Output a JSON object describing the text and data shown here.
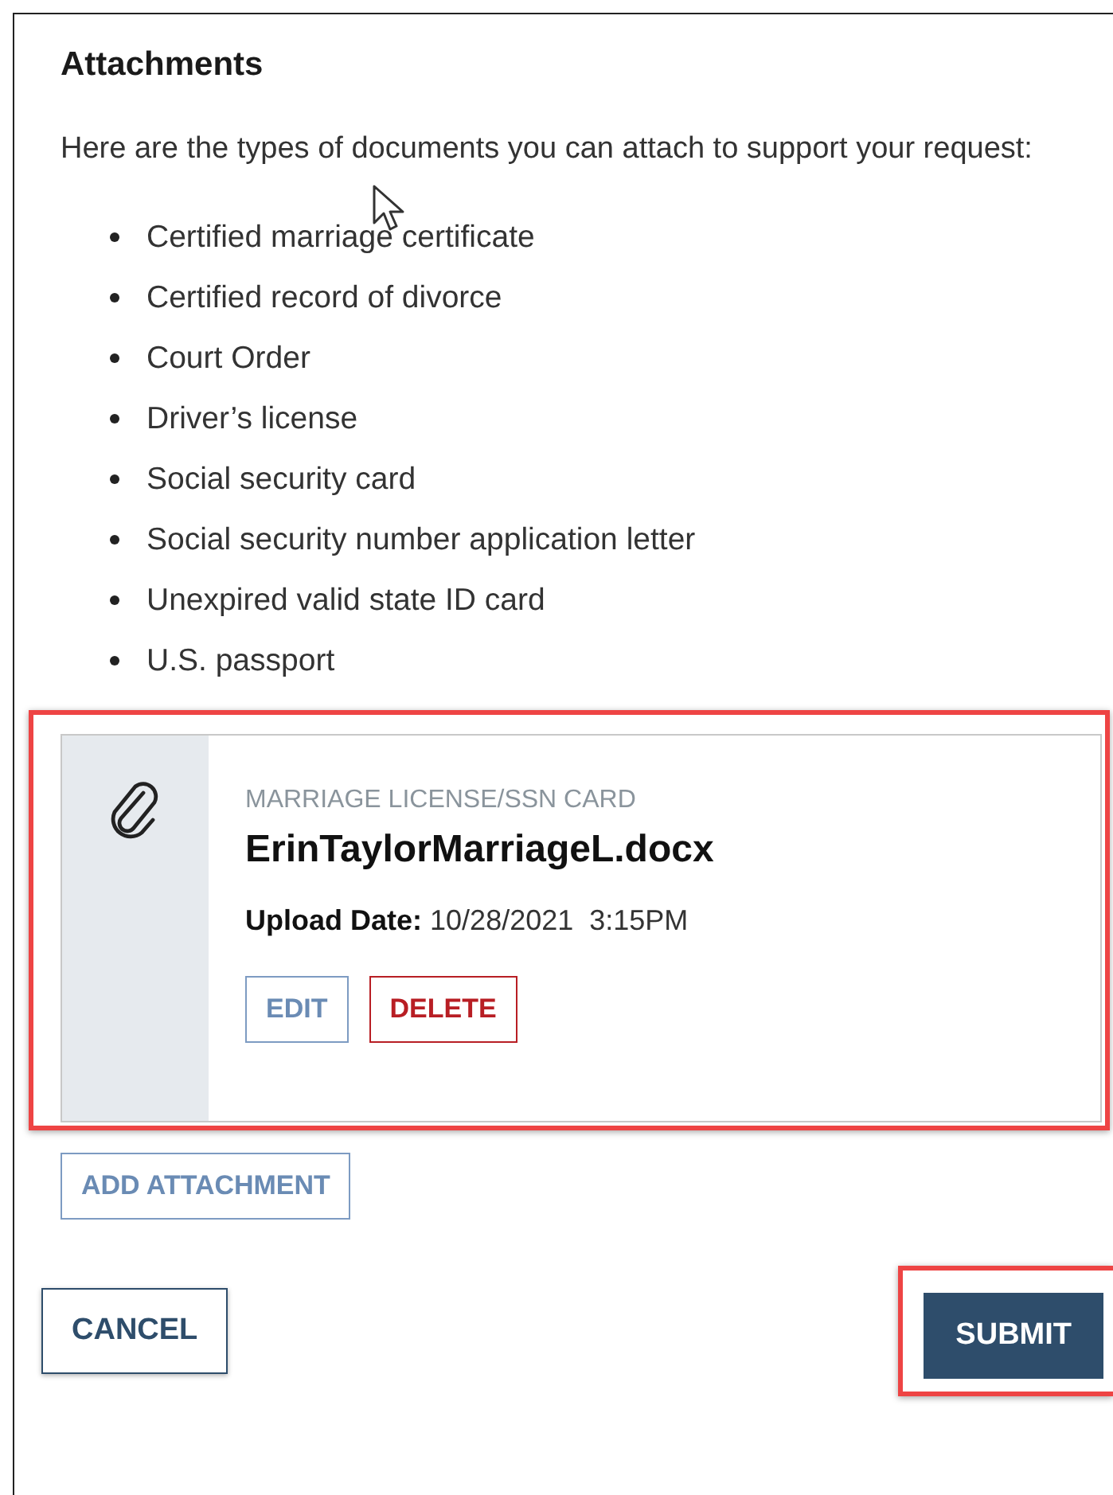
{
  "heading": "Attachments",
  "intro": "Here are the types of documents you can attach to support your request:",
  "document_types": [
    "Certified marriage certificate",
    "Certified record of divorce",
    "Court Order",
    "Driver’s license",
    "Social security card",
    "Social security number application letter",
    "Unexpired valid state ID card",
    "U.S. passport"
  ],
  "attachments": [
    {
      "category": "MARRIAGE LICENSE/SSN CARD",
      "file_name": "ErinTaylorMarriageL.docx",
      "upload_label": "Upload Date:",
      "upload_value": "10/28/2021  3:15PM",
      "actions": [
        {
          "kind": "edit",
          "label": "EDIT"
        },
        {
          "kind": "delete",
          "label": "DELETE"
        }
      ],
      "highlighted": true
    }
  ],
  "add_button": "ADD ATTACHMENT",
  "footer": {
    "cancel": "CANCEL",
    "submit": "SUBMIT",
    "submit_highlighted": true
  }
}
